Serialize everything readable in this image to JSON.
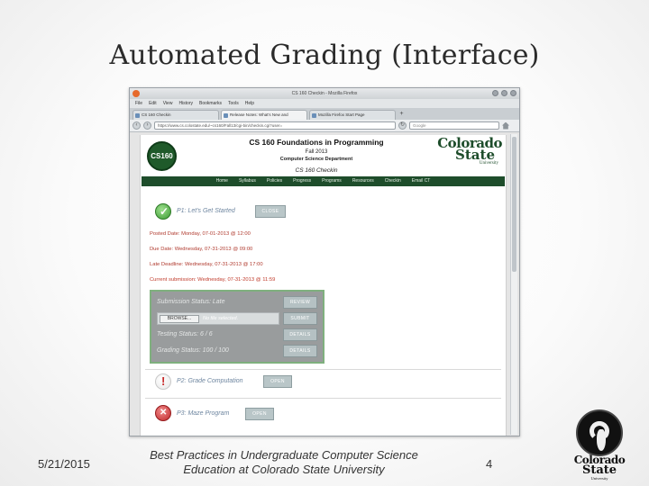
{
  "slide": {
    "title": "Automated Grading (Interface)",
    "footer_date": "5/21/2015",
    "footer_center": "Best Practices in Undergraduate Computer Science Education at Colorado State University",
    "page_number": "4",
    "logo": {
      "line1": "Colorado",
      "line2": "State",
      "line3": "University"
    }
  },
  "browser": {
    "window_title": "CS 160 Checkin - Mozilla Firefox",
    "menu": [
      "File",
      "Edit",
      "View",
      "History",
      "Bookmarks",
      "Tools",
      "Help"
    ],
    "tabs": [
      {
        "label": "CS 160 Checkin",
        "active": true
      },
      {
        "label": "Release Notes: What's New and",
        "active": false
      },
      {
        "label": "Mozilla Firefox Start Page",
        "active": false
      }
    ],
    "url": "https://www.cs.colostate.edu/~cs160/Fall13/cgi-bin/checkin.cgi?user=",
    "search_placeholder": "Google"
  },
  "site": {
    "course_logo": "CS160",
    "title": "CS 160 Foundations in Programming",
    "term": "Fall 2013",
    "department": "Computer Science Department",
    "page_heading": "CS 160 Checkin",
    "csu_logo": {
      "line1": "Colorado",
      "line2": "State",
      "line3": "University"
    },
    "nav": [
      "Home",
      "Syllabus",
      "Policies",
      "Progress",
      "Programs",
      "Resources",
      "Checkin",
      "Email CT"
    ]
  },
  "assignments": [
    {
      "name": "P1: Let's Get Started",
      "status": "complete",
      "button": "CLOSE"
    },
    {
      "name": "P2: Grade Computation",
      "status": "warning",
      "button": "OPEN"
    },
    {
      "name": "P3: Maze Program",
      "status": "error",
      "button": "OPEN"
    }
  ],
  "dates": {
    "posted": "Posted Date: Monday, 07-01-2013 @ 12:00",
    "due": "Due Date: Wednesday, 07-31-2013 @ 09:00",
    "late": "Late Deadline: Wednesday, 07-31-2013 @ 17:00",
    "current": "Current submission: Wednesday, 07-31-2013 @ 11:59"
  },
  "status_panel": {
    "submission_status": "Submission Status: Late",
    "review_button": "REVIEW",
    "browse_button": "BROWSE...",
    "file_text": "No file selected.",
    "submit_button": "SUBMIT",
    "testing_status": "Testing Status: 6 / 6",
    "testing_button": "DETAILS",
    "grading_status": "Grading Status: 100 / 100",
    "grading_button": "DETAILS"
  }
}
